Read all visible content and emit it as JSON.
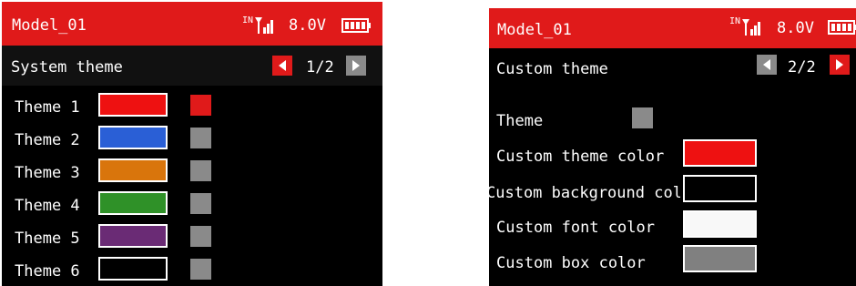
{
  "left_screen": {
    "model": "Model_01",
    "status": {
      "in_label": "IN",
      "voltage": "8.0V"
    },
    "page_title": "System theme",
    "page_indicator": "1/2",
    "themes": [
      {
        "label": "Theme 1",
        "color": "#ee1111",
        "selected": true
      },
      {
        "label": "Theme 2",
        "color": "#2a5fd6",
        "selected": false
      },
      {
        "label": "Theme 3",
        "color": "#d9750c",
        "selected": false
      },
      {
        "label": "Theme 4",
        "color": "#2f9128",
        "selected": false
      },
      {
        "label": "Theme 5",
        "color": "#6a2b75",
        "selected": false
      },
      {
        "label": "Theme 6",
        "color": "#000000",
        "selected": false
      }
    ]
  },
  "right_screen": {
    "model": "Model_01",
    "status": {
      "in_label": "IN",
      "voltage": "8.0V"
    },
    "page_title": "Custom theme",
    "page_indicator": "2/2",
    "theme_label": "Theme",
    "settings": [
      {
        "label": "Custom theme color",
        "color": "#ee1111"
      },
      {
        "label": "Custom background color",
        "color": "#000000"
      },
      {
        "label": "Custom font color",
        "color": "#f8f8f8"
      },
      {
        "label": "Custom box color",
        "color": "#808080"
      }
    ]
  },
  "colors": {
    "header": "#e01a1a",
    "accent_red": "#e01a1a",
    "inactive_gray": "#8a8a8a"
  }
}
